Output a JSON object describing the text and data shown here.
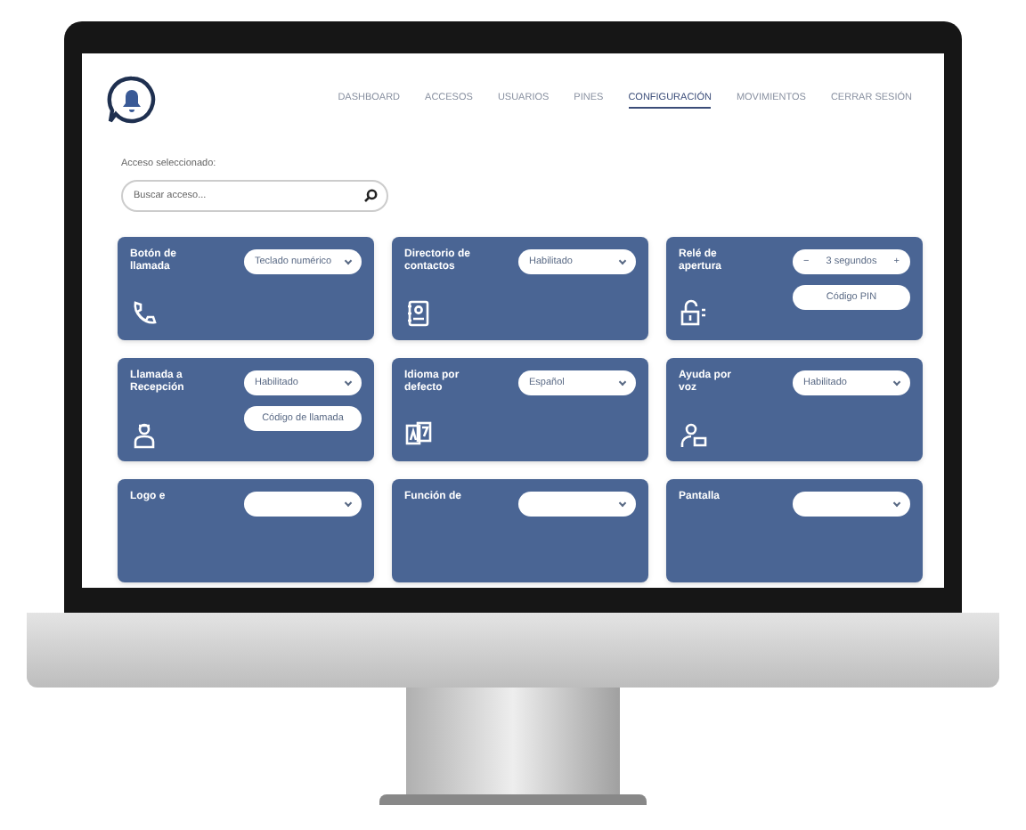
{
  "nav": [
    {
      "label": "DASHBOARD",
      "selected": false
    },
    {
      "label": "ACCESOS",
      "selected": false
    },
    {
      "label": "USUARIOS",
      "selected": false
    },
    {
      "label": "PINES",
      "selected": false
    },
    {
      "label": "CONFIGURACIÓN",
      "selected": true
    },
    {
      "label": "MOVIMIENTOS",
      "selected": false
    },
    {
      "label": "CERRAR SESIÓN",
      "selected": false
    }
  ],
  "access": {
    "label": "Acceso seleccionado:",
    "search_placeholder": "Buscar acceso..."
  },
  "cards": [
    {
      "title": "Botón de llamada",
      "controls": [
        {
          "kind": "select",
          "value": "Teclado numérico"
        }
      ]
    },
    {
      "title": "Directorio de contactos",
      "controls": [
        {
          "kind": "select",
          "value": "Habilitado"
        }
      ]
    },
    {
      "title": "Relé de apertura",
      "controls": [
        {
          "kind": "stepper",
          "value": "3 segundos",
          "minus": "−",
          "plus": "+"
        },
        {
          "kind": "button",
          "value": "Código PIN"
        }
      ]
    },
    {
      "title": "Llamada a Recepción",
      "controls": [
        {
          "kind": "select",
          "value": "Habilitado"
        },
        {
          "kind": "button",
          "value": "Código de llamada"
        }
      ]
    },
    {
      "title": "Idioma por defecto",
      "controls": [
        {
          "kind": "select",
          "value": "Español"
        }
      ]
    },
    {
      "title": "Ayuda por voz",
      "controls": [
        {
          "kind": "select",
          "value": "Habilitado"
        }
      ]
    },
    {
      "title": "Logo e",
      "controls": [
        {
          "kind": "select"
        }
      ]
    },
    {
      "title": "Función de",
      "controls": [
        {
          "kind": "select"
        }
      ]
    },
    {
      "title": "Pantalla",
      "controls": [
        {
          "kind": "select"
        }
      ]
    }
  ]
}
